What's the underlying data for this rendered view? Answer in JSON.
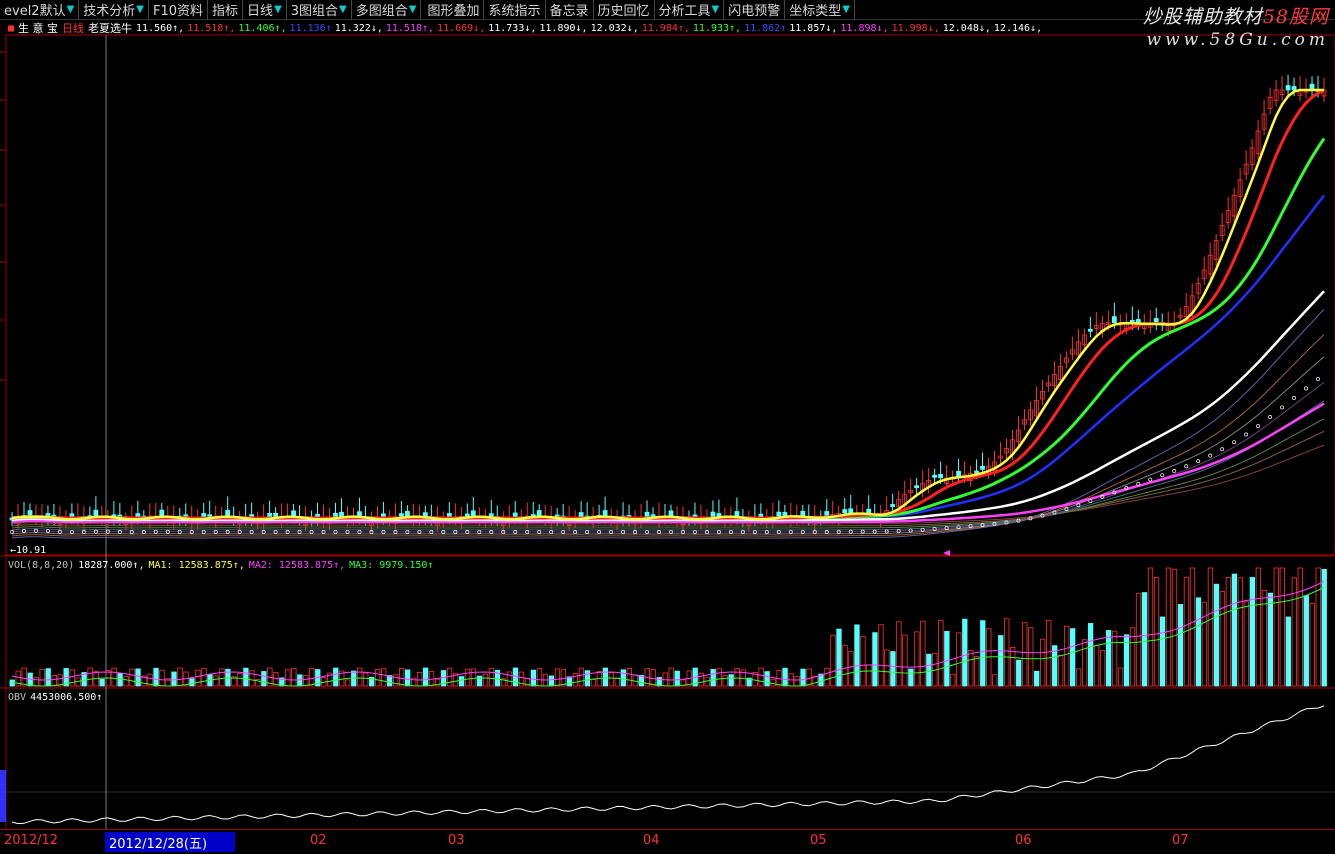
{
  "toolbar": {
    "items": [
      {
        "label": "evel2默认",
        "arrow": true
      },
      {
        "label": "技术分析",
        "arrow": true
      },
      {
        "label": "F10资料",
        "arrow": false
      },
      {
        "label": "指标",
        "arrow": false
      },
      {
        "label": "日线",
        "arrow": true
      },
      {
        "label": "3图组合",
        "arrow": true
      },
      {
        "label": "多图组合",
        "arrow": true
      },
      {
        "label": "图形叠加",
        "arrow": false
      },
      {
        "label": "系统指示",
        "arrow": false
      },
      {
        "label": "备忘录",
        "arrow": false
      },
      {
        "label": "历史回忆",
        "arrow": false
      },
      {
        "label": "分析工具",
        "arrow": true
      },
      {
        "label": "闪电预警",
        "arrow": false
      },
      {
        "label": "坐标类型",
        "arrow": true
      }
    ]
  },
  "watermark": {
    "text_main": "炒股辅助教材",
    "text_brand": "58股网",
    "url": "www.58Gu.com"
  },
  "price_header": {
    "app_name": "生 意 宝",
    "period": "日线",
    "formula": "老夏选牛",
    "values": [
      {
        "text": "11.560↑,",
        "color": "#ffffff"
      },
      {
        "text": "11.518↑,",
        "color": "#ff3030"
      },
      {
        "text": "11.406↑,",
        "color": "#30ff30"
      },
      {
        "text": "11.136↑",
        "color": "#3050ff"
      },
      {
        "text": "11.322↓,",
        "color": "#ffffff"
      },
      {
        "text": "11.518↑,",
        "color": "#ff40ff"
      },
      {
        "text": "11.669↓,",
        "color": "#ff3030"
      },
      {
        "text": "11.733↓,",
        "color": "#ffffff"
      },
      {
        "text": "11.890↓,",
        "color": "#ffffff"
      },
      {
        "text": "12.032↓,",
        "color": "#ffffff"
      },
      {
        "text": "11.984↑,",
        "color": "#ff3030"
      },
      {
        "text": "11.933↑,",
        "color": "#30ff30"
      },
      {
        "text": "11.862↑",
        "color": "#3050ff"
      },
      {
        "text": "11.857↓,",
        "color": "#ffffff"
      },
      {
        "text": "11.898↓,",
        "color": "#ff40ff"
      },
      {
        "text": "11.998↓,",
        "color": "#ff3030"
      },
      {
        "text": "12.048↓,",
        "color": "#ffffff"
      },
      {
        "text": "12.146↓,",
        "color": "#ffffff"
      }
    ]
  },
  "price_panel": {
    "low_label": "←10.91"
  },
  "volume_header": {
    "name": "VOL(8,8,20)",
    "value": "18287.000↑,",
    "ma1": "MA1: 12583.875↑,",
    "ma2": "MA2: 12583.875↑,",
    "ma3": "MA3: 9979.150↑"
  },
  "obv_header": {
    "name": "OBV",
    "value": "4453006.500↑"
  },
  "date_axis": {
    "first_label": "2012/12",
    "cursor_date": "2012/12/28(五)",
    "months": [
      "02",
      "03",
      "04",
      "05",
      "06",
      "07"
    ]
  },
  "colors": {
    "up": "#ff3030",
    "down": "#54ffff",
    "ma5": "#ffff40",
    "ma10": "#ff2020",
    "ma20": "#30ff30",
    "ma30": "#2030ff",
    "ma60": "#ffffff",
    "ma120": "#ff40ff",
    "grid": "#a00000"
  }
}
